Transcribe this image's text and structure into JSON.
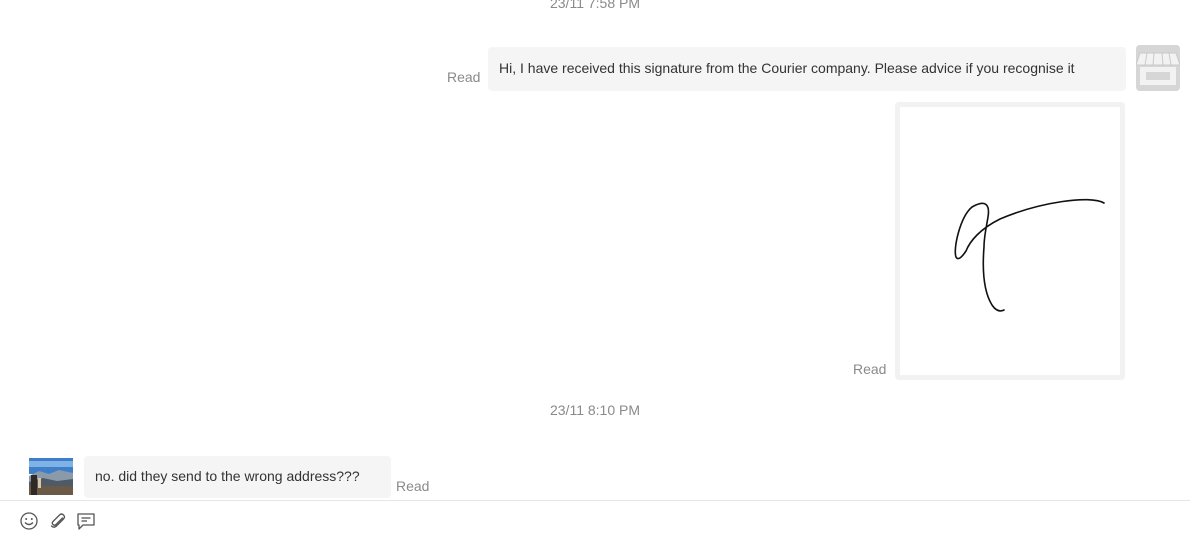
{
  "chat": {
    "timestamp_top": "23/11 7:58 PM",
    "timestamp_mid": "23/11 8:10 PM",
    "messages": [
      {
        "text": "Hi, I have received this signature from the Courier company. Please advice if you recognise it",
        "status": "Read"
      },
      {
        "type": "image",
        "status": "Read"
      },
      {
        "text": "no. did they send to the wrong address???",
        "status": "Read"
      }
    ]
  },
  "icons": {
    "shop_avatar": "store-icon",
    "user_avatar": "mountain-photo",
    "emoji": "emoji-icon",
    "attach": "paperclip-icon",
    "quick_reply": "message-template-icon"
  },
  "colors": {
    "bubble": "#f5f5f5",
    "status_text": "#8a8a8a",
    "divider": "#e6e6e6"
  }
}
